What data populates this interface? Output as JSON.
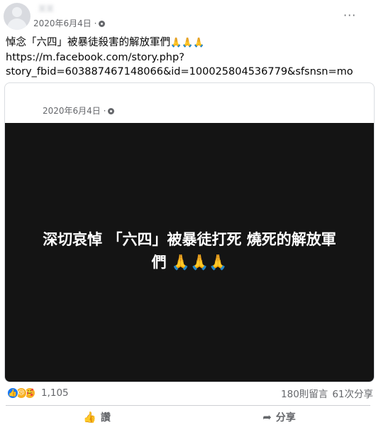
{
  "post": {
    "author": "某某",
    "date": "2020年6月4日 ·",
    "more_icon": "more-icon",
    "text_line1": "悼念「六四」被暴徒殺害的解放軍們",
    "text_line1_emoji": "🙏🙏🙏",
    "text_line2": "https://m.facebook.com/story.php?",
    "text_line3": "story_fbid=603887467148066&id=100025804536779&sfsnsn=mo"
  },
  "shared": {
    "date": "2020年6月4日 ·",
    "video_text_line1": "深切哀悼 「六四」被暴徒打死 燒死的解放軍",
    "video_text_line2": "們 🙏🙏🙏"
  },
  "footer": {
    "reaction_count": "1,105",
    "comments": "180則留言",
    "shares": "61次分享",
    "like_label": "讚",
    "share_label": "分享"
  },
  "colors": {
    "accent": "#1877f2",
    "muted": "#65676b",
    "video_bg": "#141414"
  }
}
